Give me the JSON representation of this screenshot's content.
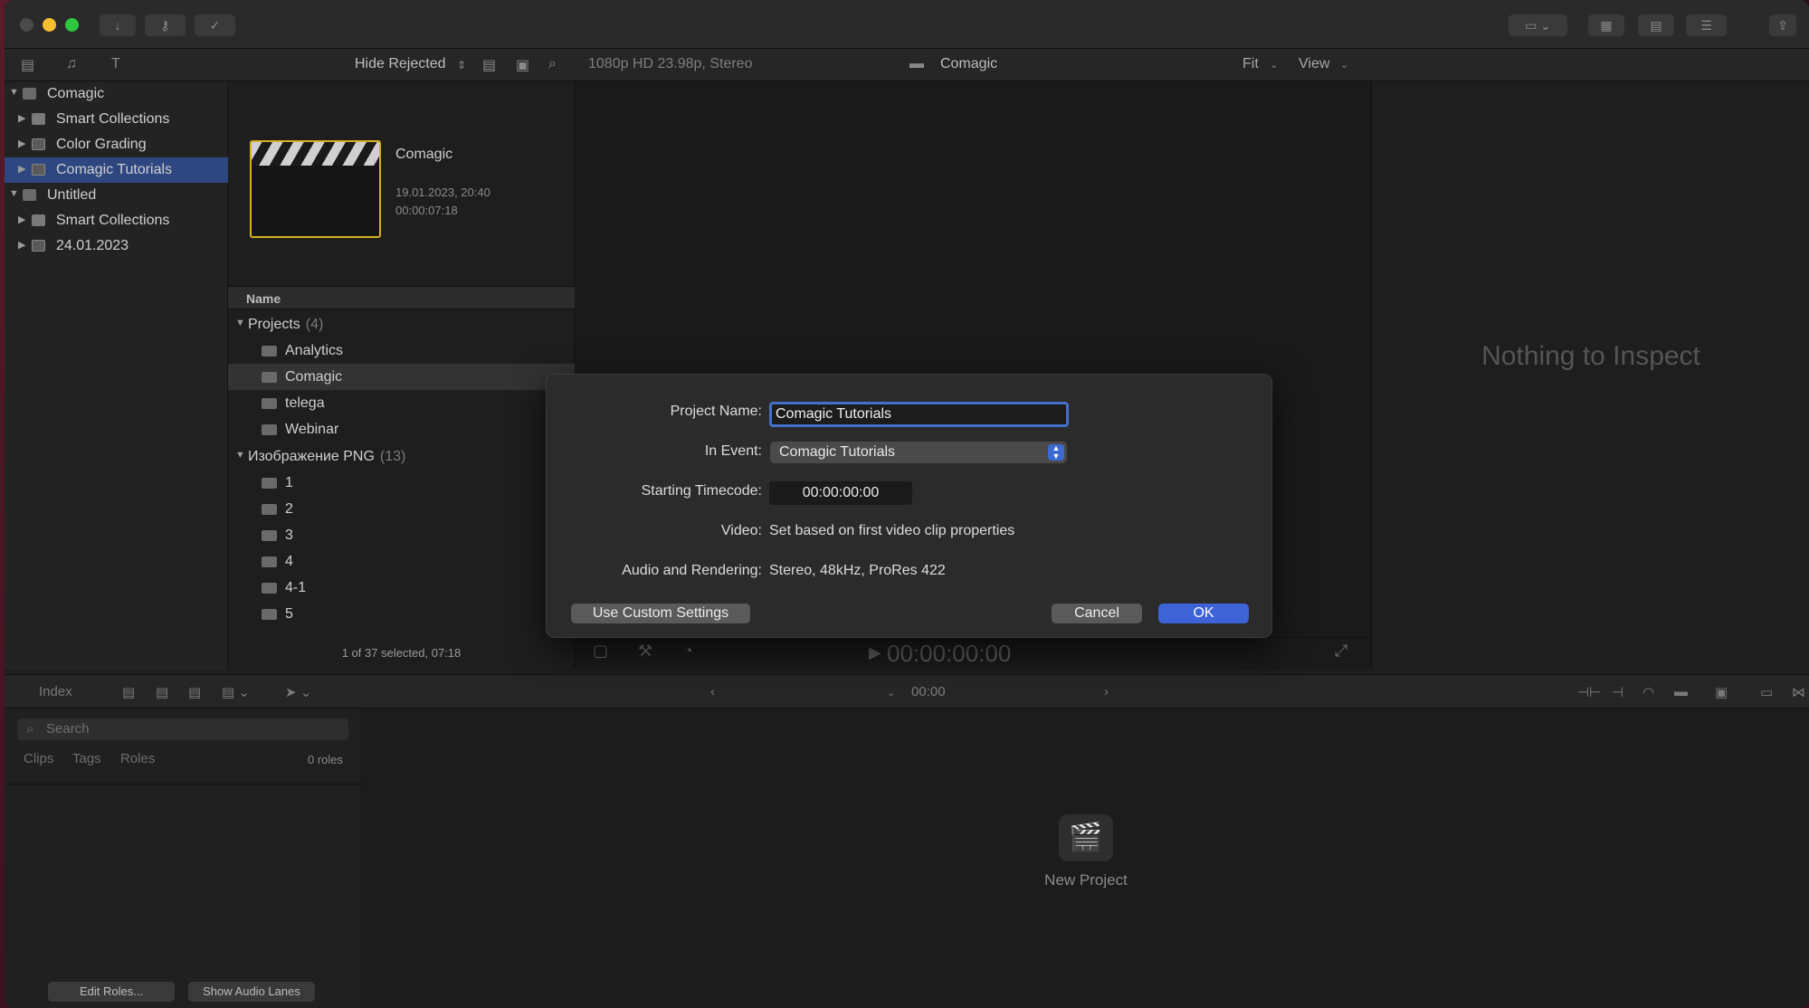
{
  "toolbar": {
    "hide_rejected": "Hide Rejected",
    "format": "1080p HD 23.98p, Stereo",
    "viewer_title": "Comagic",
    "fit": "Fit",
    "view": "View"
  },
  "sidebar": {
    "items": [
      {
        "label": "Comagic"
      },
      {
        "label": "Smart Collections"
      },
      {
        "label": "Color Grading"
      },
      {
        "label": "Comagic Tutorials"
      },
      {
        "label": "Untitled"
      },
      {
        "label": "Smart Collections"
      },
      {
        "label": "24.01.2023"
      }
    ]
  },
  "browser": {
    "clip_title": "Comagic",
    "clip_date": "19.01.2023, 20:40",
    "clip_duration": "00:00:07:18",
    "column_name": "Name",
    "projects_group": "Projects",
    "projects_count": "(4)",
    "projects": [
      "Analytics",
      "Comagic",
      "telega",
      "Webinar"
    ],
    "images_group": "Изображение PNG",
    "images_count": "(13)",
    "images": [
      "1",
      "2",
      "3",
      "4",
      "4-1",
      "5"
    ],
    "footer": "1 of 37 selected, 07:18"
  },
  "viewer": {
    "timecode": "00:00:00:00"
  },
  "inspector": {
    "empty_text": "Nothing to Inspect"
  },
  "timeline_bar": {
    "index_tab": "Index",
    "timecode": "00:00"
  },
  "index_panel": {
    "search_placeholder": "Search",
    "tabs": [
      "Clips",
      "Tags",
      "Roles"
    ],
    "roles_count": "0 roles",
    "edit_roles": "Edit Roles...",
    "show_audio_lanes": "Show Audio Lanes"
  },
  "timeline": {
    "new_project": "New Project"
  },
  "dialog": {
    "project_name_label": "Project Name:",
    "project_name_value": "Comagic Tutorials",
    "in_event_label": "In Event:",
    "in_event_value": "Comagic Tutorials",
    "starting_timecode_label": "Starting Timecode:",
    "starting_timecode_value": "00:00:00:00",
    "video_label": "Video:",
    "video_value": "Set based on first video clip properties",
    "audio_label": "Audio and Rendering:",
    "audio_value": "Stereo, 48kHz, ProRes 422",
    "custom_settings_button": "Use Custom Settings",
    "cancel_button": "Cancel",
    "ok_button": "OK"
  },
  "colors": {
    "accent": "#3d63d6",
    "selection": "#2e4780",
    "thumbnail_border": "#d8b020"
  }
}
